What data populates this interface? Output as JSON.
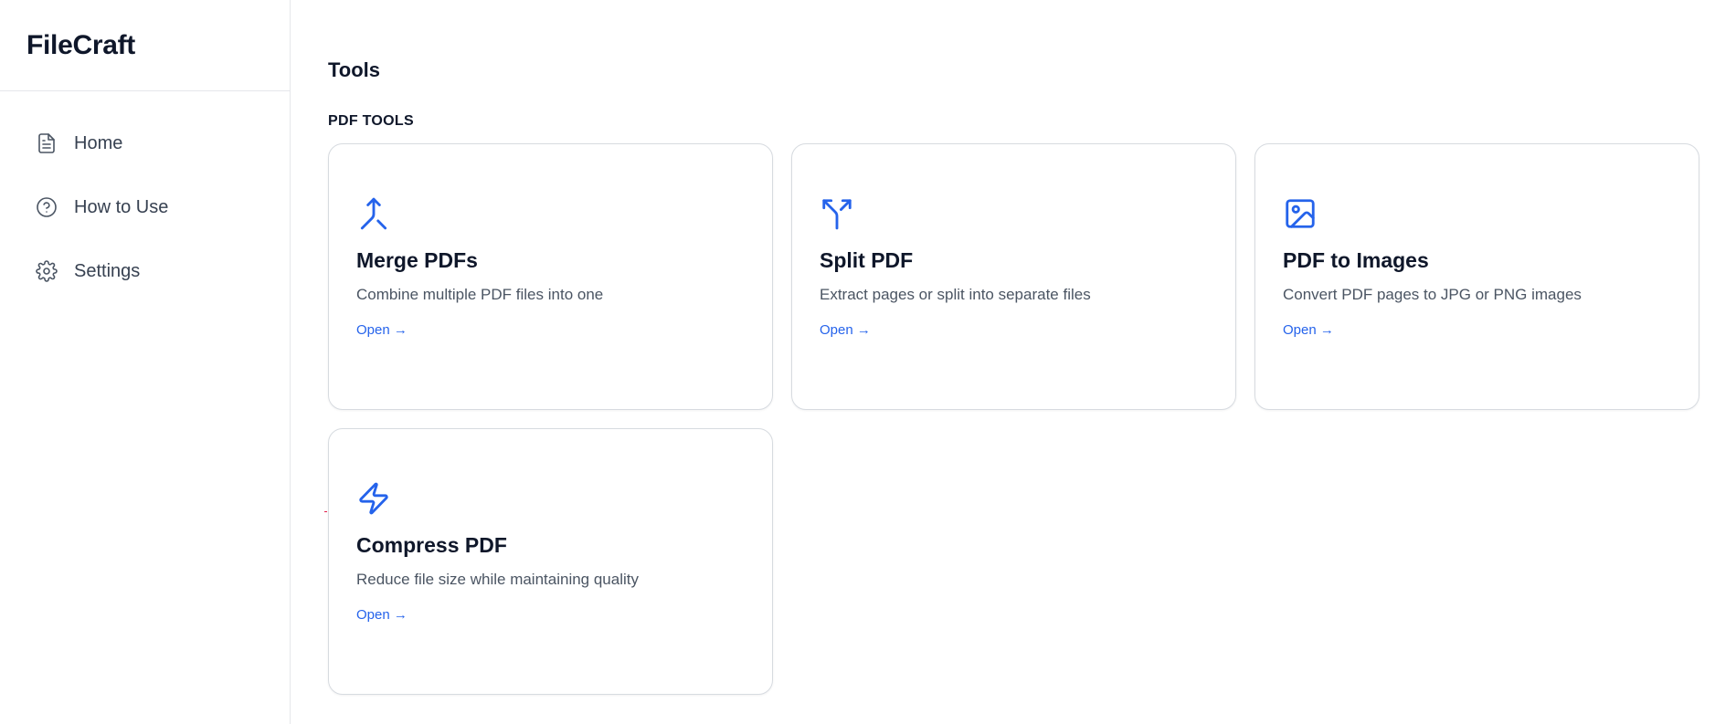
{
  "app": {
    "name": "FileCraft"
  },
  "sidebar": {
    "items": [
      {
        "label": "Home",
        "icon": "document-icon"
      },
      {
        "label": "How to Use",
        "icon": "help-circle-icon"
      },
      {
        "label": "Settings",
        "icon": "gear-icon"
      }
    ]
  },
  "main": {
    "title": "Tools",
    "section_title": "PDF TOOLS",
    "cards": [
      {
        "title": "Merge PDFs",
        "description": "Combine multiple PDF files into one",
        "link": "Open →",
        "icon": "merge-icon"
      },
      {
        "title": "Split PDF",
        "description": "Extract pages or split into separate files",
        "link": "Open →",
        "icon": "split-icon"
      },
      {
        "title": "PDF to Images",
        "description": "Convert PDF pages to JPG or PNG images",
        "link": "Open →",
        "icon": "image-icon"
      },
      {
        "title": "Compress PDF",
        "description": "Reduce file size while maintaining quality",
        "link": "Open →",
        "icon": "lightning-icon"
      }
    ]
  },
  "colors": {
    "accent": "#2563eb",
    "text_primary": "#0f172a",
    "text_secondary": "#4b5563",
    "border": "#e5e7eb"
  }
}
